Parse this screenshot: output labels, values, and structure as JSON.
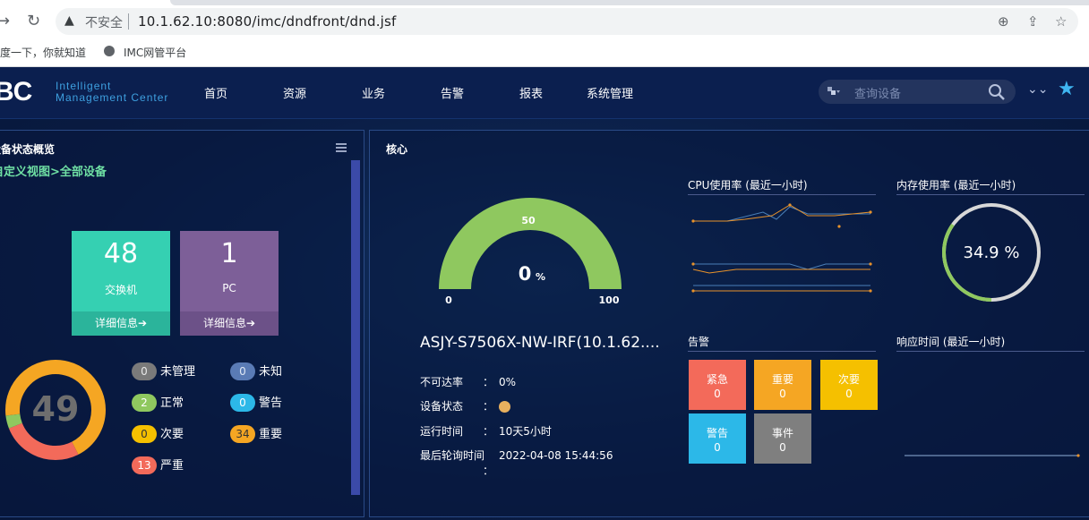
{
  "browser": {
    "warning_icon": "warning-triangle-icon",
    "insecure_label": "不安全",
    "url": "10.1.62.10:8080/imc/dndfront/dnd.jsf",
    "bookmarks": [
      "百度一下，你就知道",
      "IMC网管平台"
    ]
  },
  "header": {
    "logo_mark": "BC",
    "logo_line1": "Intelligent",
    "logo_line2": "Management Center",
    "menu": [
      "首页",
      "资源",
      "业务",
      "告警",
      "报表",
      "系统管理"
    ],
    "search_placeholder": "查询设备"
  },
  "overview": {
    "title": "设备状态概览",
    "view_link": "自定义视图>全部设备",
    "tiles": [
      {
        "count": "48",
        "label": "交换机",
        "detail": "详细信息➔"
      },
      {
        "count": "1",
        "label": "PC",
        "detail": "详细信息➔"
      }
    ],
    "total": "49",
    "donut_fractions": {
      "major": 0.694,
      "critical": 0.265,
      "normal": 0.041
    },
    "status": [
      {
        "count": "0",
        "label": "未管理"
      },
      {
        "count": "0",
        "label": "未知"
      },
      {
        "count": "2",
        "label": "正常"
      },
      {
        "count": "0",
        "label": "警告"
      },
      {
        "count": "0",
        "label": "次要"
      },
      {
        "count": "34",
        "label": "重要"
      },
      {
        "count": "13",
        "label": "严重"
      }
    ]
  },
  "core": {
    "title": "核心",
    "gauge": {
      "value": "0",
      "unit": "%",
      "min": "0",
      "mid": "50",
      "max": "100",
      "level": 0
    },
    "device_name": "ASJY-S7506X-NW-IRF(10.1.62....",
    "rows": [
      {
        "key": "不可达率",
        "sep": "：",
        "value": "0%"
      },
      {
        "key": "设备状态",
        "sep": "：",
        "value": ""
      },
      {
        "key": "运行时间",
        "sep": "：",
        "value": "10天5小时"
      },
      {
        "key": "最后轮询时间",
        "sep": "：",
        "value": "2022-04-08 15:44:56"
      }
    ],
    "cpu_title": "CPU使用率 (最近一小时)",
    "mem_title": "内存使用率 (最近一小时)",
    "mem_value": "34.9 %",
    "mem_level": 0.349,
    "alarm_title": "告警",
    "resp_title": "响应时间 (最近一小时)",
    "alarms": [
      {
        "label": "紧急",
        "count": "0"
      },
      {
        "label": "重要",
        "count": "0"
      },
      {
        "label": "次要",
        "count": "0"
      },
      {
        "label": "警告",
        "count": "0"
      },
      {
        "label": "事件",
        "count": "0"
      }
    ]
  },
  "colors": {
    "normal": "#8fc85f",
    "critical": "#f36a5a",
    "major": "#f5a623",
    "accent": "#3fb5f0"
  }
}
